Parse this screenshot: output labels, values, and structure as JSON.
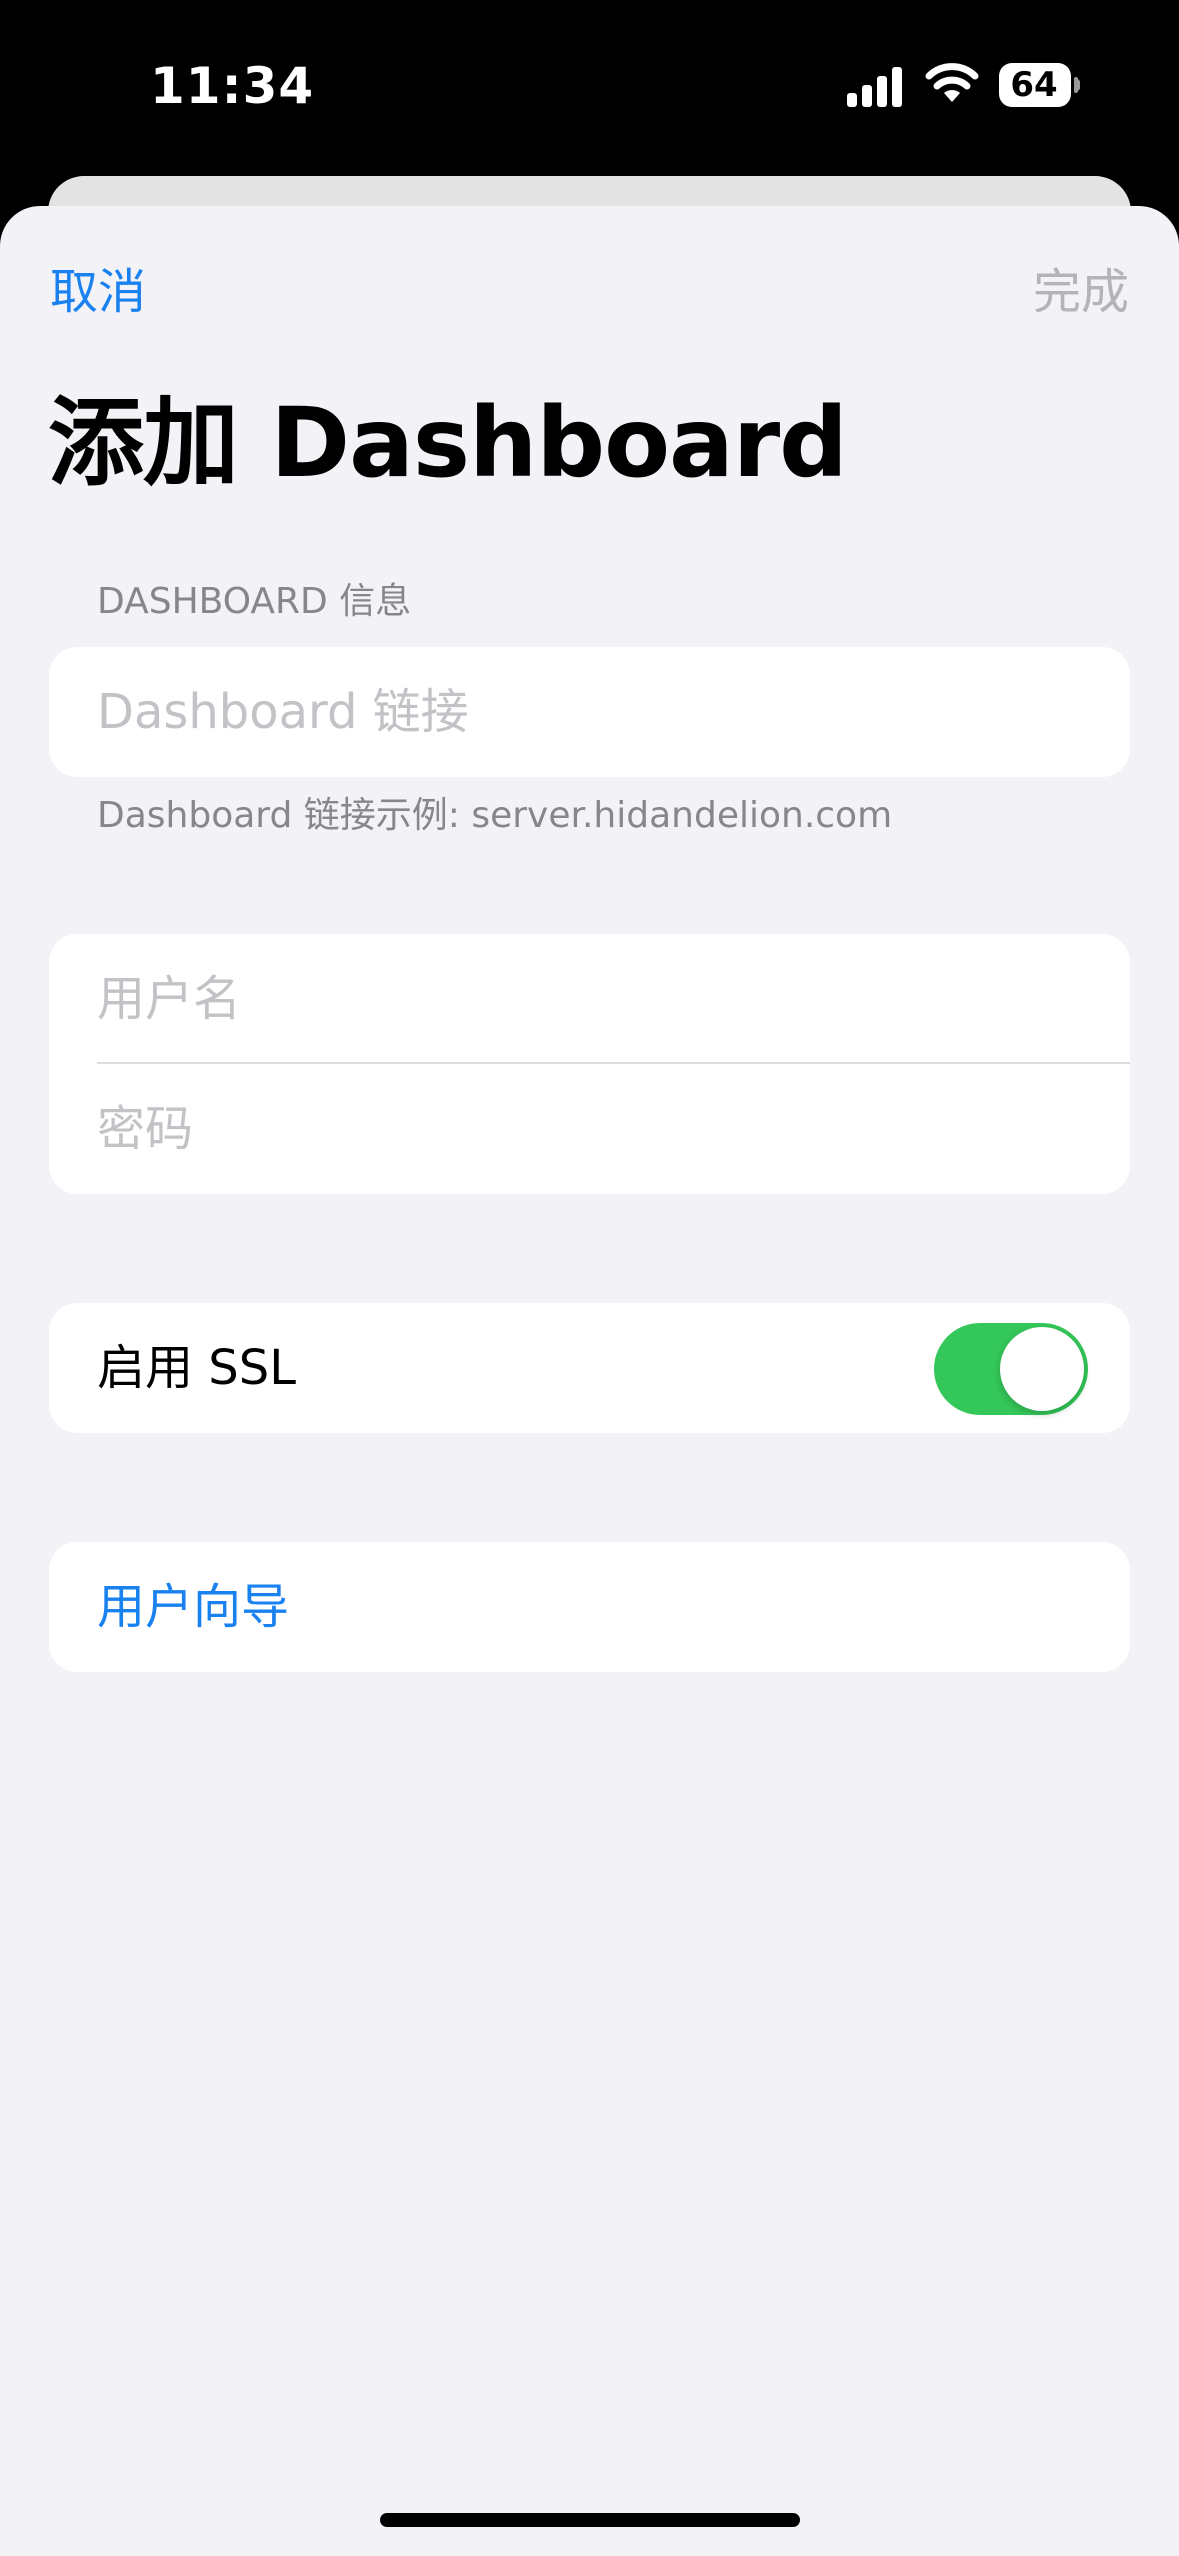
{
  "status_bar": {
    "time": "11:34",
    "battery_level": "64",
    "battery_percent": 64,
    "icons": [
      "signal-icon",
      "wifi-icon",
      "battery-icon"
    ]
  },
  "nav": {
    "cancel_label": "取消",
    "done_label": "完成"
  },
  "page": {
    "title": "添加 Dashboard"
  },
  "dashboard_section": {
    "header": "DASHBOARD 信息",
    "url_placeholder": "Dashboard 链接",
    "url_value": "",
    "footer": "Dashboard 链接示例: server.hidandelion.com"
  },
  "credentials": {
    "username_placeholder": "用户名",
    "username_value": "",
    "password_placeholder": "密码",
    "password_value": ""
  },
  "ssl": {
    "label": "启用 SSL",
    "enabled": true
  },
  "guide": {
    "label": "用户向导"
  },
  "colors": {
    "accent": "#1a82f0",
    "toggle_on": "#34c759",
    "background": "#f2f2f7",
    "disabled_text": "#b3b3b8",
    "secondary_text": "#86868b"
  }
}
